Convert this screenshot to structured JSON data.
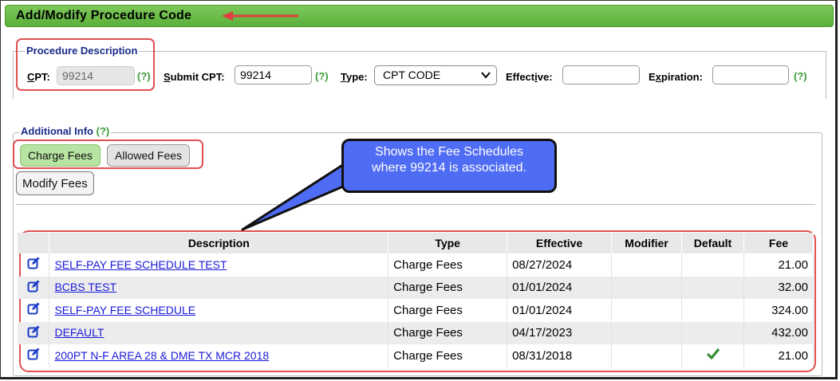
{
  "page": {
    "title": "Add/Modify Procedure Code"
  },
  "procedure_description": {
    "legend": "Procedure Description",
    "cpt_label": "CPT:",
    "cpt_value": "99214",
    "help": "(?)",
    "submit_cpt_label": "Submit CPT:",
    "submit_cpt_value": "99214",
    "type_label": "Type:",
    "type_value": "CPT CODE",
    "effective_label": "Effective:",
    "effective_value": "",
    "expiration_label": "Expiration:",
    "expiration_value": ""
  },
  "additional_info": {
    "legend": "Additional Info",
    "help": "(?)",
    "tabs": [
      {
        "label": "Charge Fees",
        "active": true
      },
      {
        "label": "Allowed Fees",
        "active": false
      }
    ],
    "modify_button": "Modify Fees"
  },
  "callout": {
    "line1": "Shows the Fee Schedules",
    "line2": "where 99214 is associated."
  },
  "table": {
    "headers": [
      "",
      "Description",
      "Type",
      "Effective",
      "Modifier",
      "Default",
      "Fee"
    ],
    "rows": [
      {
        "description": "SELF-PAY FEE SCHEDULE TEST",
        "type": "Charge Fees",
        "effective": "08/27/2024",
        "modifier": "",
        "default": false,
        "fee": "21.00"
      },
      {
        "description": "BCBS TEST",
        "type": "Charge Fees",
        "effective": "01/01/2024",
        "modifier": "",
        "default": false,
        "fee": "32.00"
      },
      {
        "description": "SELF-PAY FEE SCHEDULE",
        "type": "Charge Fees",
        "effective": "01/01/2024",
        "modifier": "",
        "default": false,
        "fee": "324.00"
      },
      {
        "description": "DEFAULT",
        "type": "Charge Fees",
        "effective": "04/17/2023",
        "modifier": "",
        "default": false,
        "fee": "432.00"
      },
      {
        "description": "200PT N-F AREA 28 & DME TX MCR 2018",
        "type": "Charge Fees",
        "effective": "08/31/2018",
        "modifier": "",
        "default": true,
        "fee": "21.00"
      }
    ]
  },
  "colors": {
    "title_bar": "#5cb03a",
    "highlight": "#e05050",
    "callout": "#4f6cf4",
    "link": "#1a1adb",
    "check": "#2e8b2e"
  }
}
